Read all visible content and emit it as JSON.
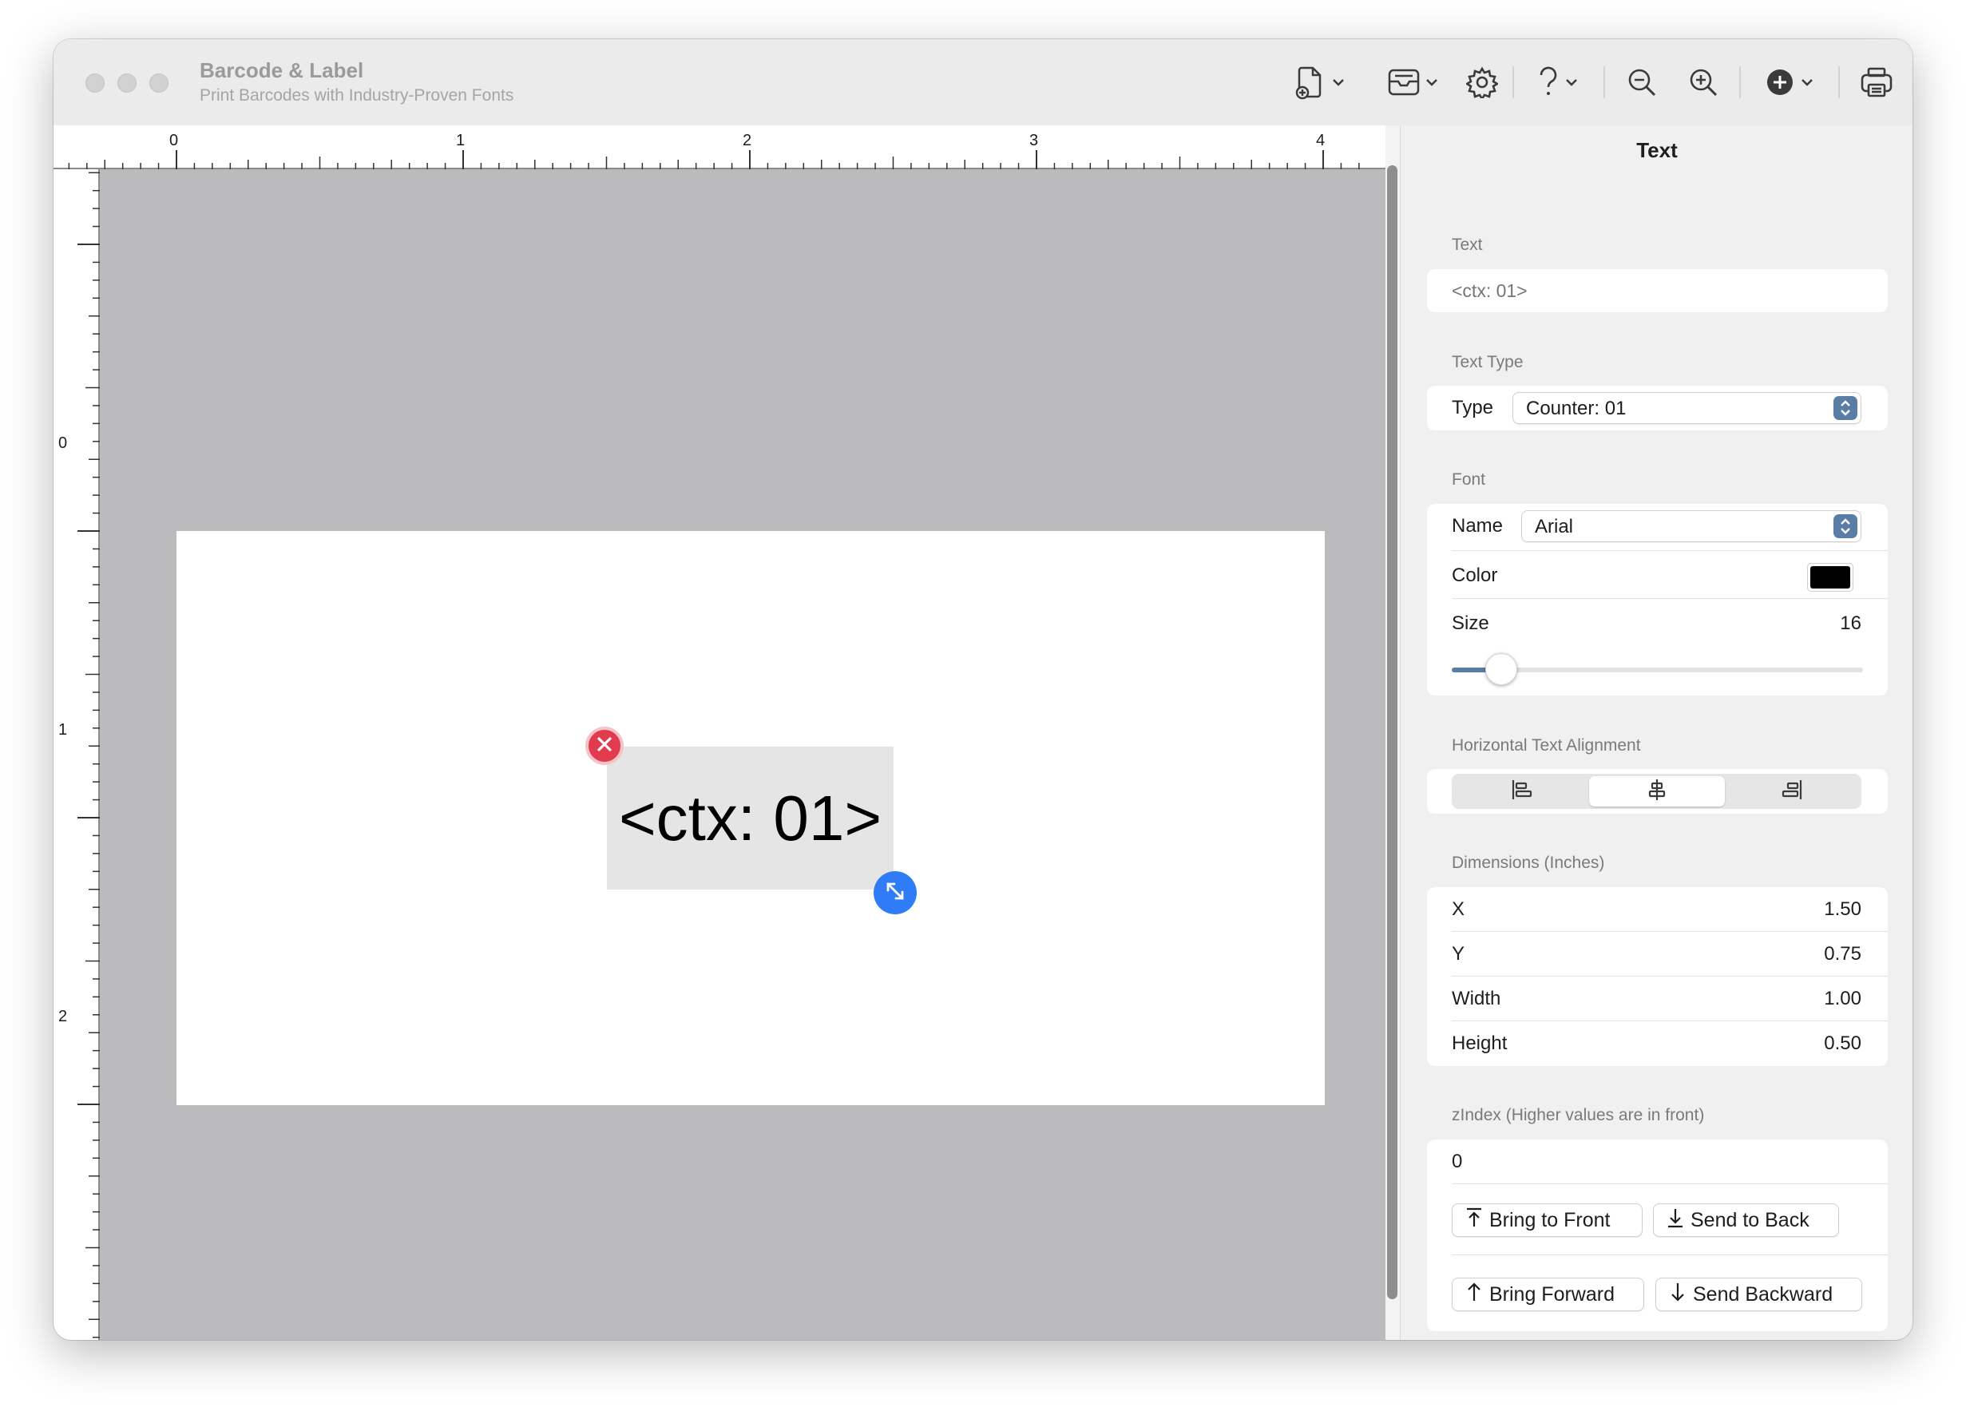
{
  "window": {
    "title": "Barcode & Label",
    "subtitle": "Print Barcodes with Industry-Proven Fonts"
  },
  "toolbar": {
    "icons": [
      "new-document-icon",
      "chevron-down-icon",
      "tray-icon",
      "chevron-down-icon",
      "gear-icon",
      "question-icon",
      "chevron-down-icon",
      "zoom-out-icon",
      "zoom-in-icon",
      "add-circle-icon",
      "chevron-down-icon",
      "print-icon"
    ]
  },
  "rulers": {
    "horizontal_labels": [
      "0",
      "1",
      "2",
      "3",
      "4"
    ],
    "vertical_labels": [
      "0",
      "1",
      "2"
    ]
  },
  "canvas": {
    "element_text": "<ctx: 01>",
    "page_color": "#ffffff",
    "background_color": "#bbbbbd"
  },
  "inspector": {
    "title": "Text",
    "text_section": {
      "label": "Text",
      "placeholder": "<ctx: 01>"
    },
    "text_type_section": {
      "label": "Text Type",
      "type_label": "Type",
      "type_value": "Counter: 01"
    },
    "font_section": {
      "label": "Font",
      "name_label": "Name",
      "name_value": "Arial",
      "color_label": "Color",
      "color_value": "#000000",
      "size_label": "Size",
      "size_value": "16",
      "size_slider_fraction": 0.12
    },
    "alignment_section": {
      "label": "Horizontal Text Alignment",
      "options": [
        "align-left-icon",
        "align-center-icon",
        "align-right-icon"
      ],
      "selected": "align-center-icon"
    },
    "dimensions_section": {
      "label": "Dimensions (Inches)",
      "rows": [
        {
          "label": "X",
          "value": "1.50"
        },
        {
          "label": "Y",
          "value": "0.75"
        },
        {
          "label": "Width",
          "value": "1.00"
        },
        {
          "label": "Height",
          "value": "0.50"
        }
      ]
    },
    "zindex_section": {
      "label": "zIndex (Higher values are in front)",
      "value": "0",
      "bring_to_front": "Bring to Front",
      "send_to_back": "Send to Back",
      "bring_forward": "Bring Forward",
      "send_backward": "Send Backward"
    }
  },
  "colors": {
    "accent": "#2f7cf6",
    "delete": "#e03c4e",
    "control_accent": "#5a7da6"
  }
}
